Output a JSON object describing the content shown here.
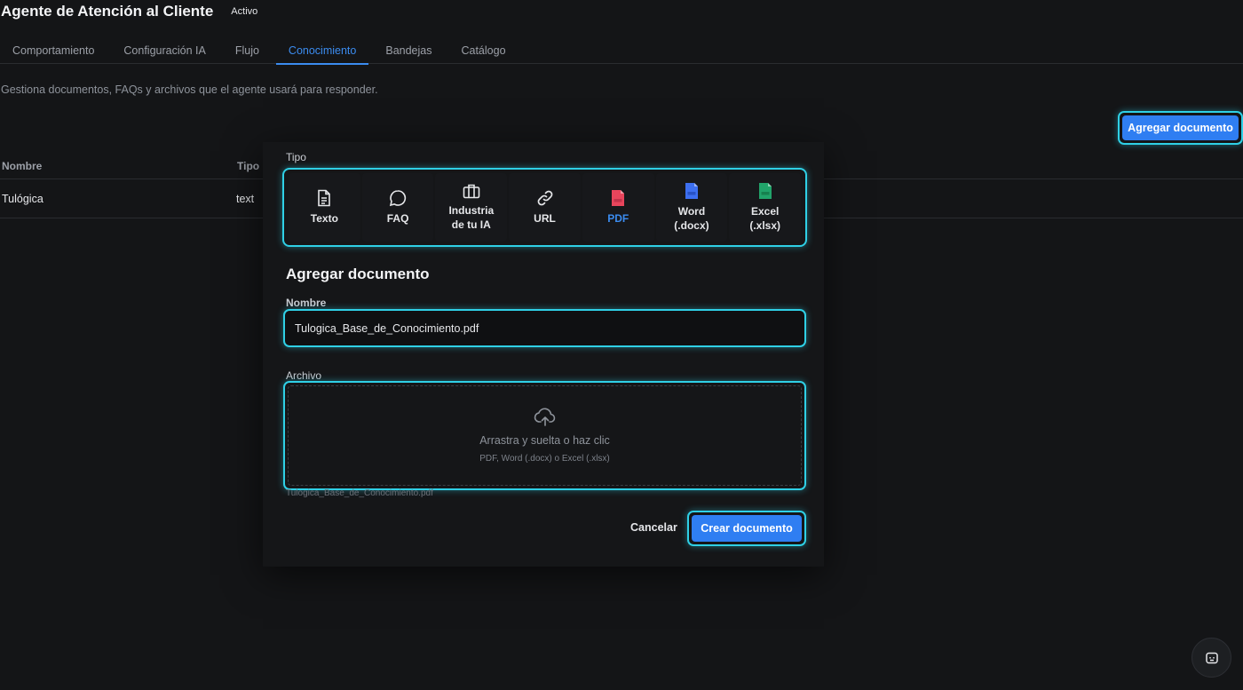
{
  "header": {
    "title": "Agente de Atención al Cliente",
    "status": "Activo"
  },
  "tabs": [
    {
      "label": "Comportamiento",
      "active": false
    },
    {
      "label": "Configuración IA",
      "active": false
    },
    {
      "label": "Flujo",
      "active": false
    },
    {
      "label": "Conocimiento",
      "active": true
    },
    {
      "label": "Bandejas",
      "active": false
    },
    {
      "label": "Catálogo",
      "active": false
    }
  ],
  "knowledge": {
    "description": "Gestiona documentos, FAQs y archivos que el agente usará para responder.",
    "add_button": "Agregar documento",
    "table": {
      "headers": {
        "name": "Nombre",
        "type": "Tipo"
      },
      "rows": [
        {
          "name": "Tulógica",
          "type": "text"
        }
      ]
    }
  },
  "modal": {
    "type_label": "Tipo",
    "types": [
      {
        "label": "Texto",
        "icon": "file-text-icon"
      },
      {
        "label": "FAQ",
        "icon": "chat-bubble-icon"
      },
      {
        "label": "Industria\nde tu IA",
        "icon": "briefcase-icon"
      },
      {
        "label": "URL",
        "icon": "link-icon"
      },
      {
        "label": "PDF",
        "icon": "pdf-file-icon",
        "selected": true
      },
      {
        "label": "Word\n(.docx)",
        "icon": "word-file-icon"
      },
      {
        "label": "Excel\n(.xlsx)",
        "icon": "excel-file-icon"
      }
    ],
    "title": "Agregar documento",
    "name_label": "Nombre",
    "name_value": "Tulogica_Base_de_Conocimiento.pdf",
    "file_label": "Archivo",
    "dropzone_main": "Arrastra y suelta o haz clic",
    "dropzone_sub": "PDF, Word (.docx) o Excel (.xlsx)",
    "selected_file": "Tulogica_Base_de_Conocimiento.pdf",
    "cancel": "Cancelar",
    "create": "Crear documento"
  },
  "colors": {
    "accent": "#2f7ef2",
    "highlight": "#2fd0e6",
    "pdf": "#e8455c",
    "word": "#3d6ff0",
    "excel": "#21a36a"
  }
}
